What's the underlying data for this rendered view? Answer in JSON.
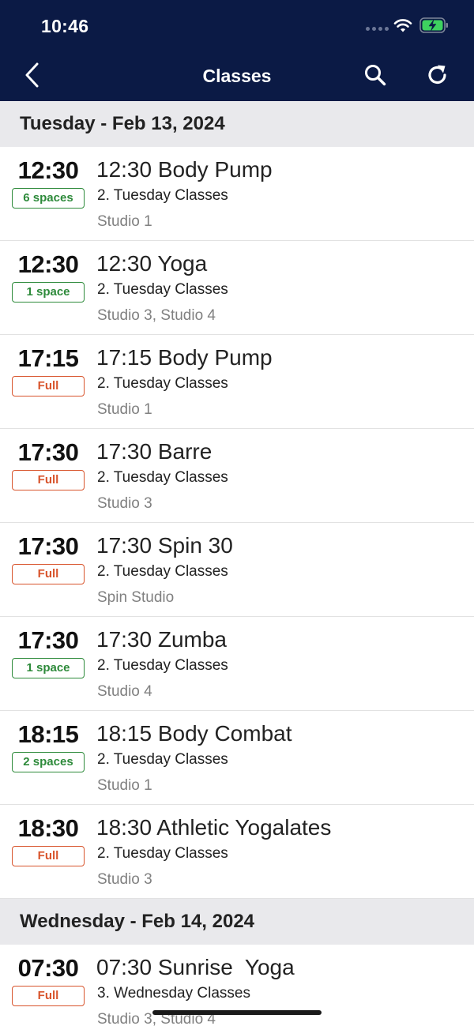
{
  "status_bar": {
    "time": "10:46"
  },
  "nav": {
    "title": "Classes"
  },
  "sections": [
    {
      "date": "Tuesday - Feb 13, 2024",
      "rows": [
        {
          "time": "12:30",
          "badge": "6 spaces",
          "badge_status": "available",
          "name": "12:30 Body Pump",
          "group": "2. Tuesday Classes",
          "room": "Studio 1"
        },
        {
          "time": "12:30",
          "badge": "1 space",
          "badge_status": "available",
          "name": "12:30 Yoga",
          "group": "2. Tuesday Classes",
          "room": "Studio 3, Studio 4"
        },
        {
          "time": "17:15",
          "badge": "Full",
          "badge_status": "full",
          "name": "17:15 Body Pump",
          "group": "2. Tuesday Classes",
          "room": "Studio 1"
        },
        {
          "time": "17:30",
          "badge": "Full",
          "badge_status": "full",
          "name": "17:30 Barre",
          "group": "2. Tuesday Classes",
          "room": "Studio 3"
        },
        {
          "time": "17:30",
          "badge": "Full",
          "badge_status": "full",
          "name": "17:30 Spin 30",
          "group": "2. Tuesday Classes",
          "room": "Spin Studio"
        },
        {
          "time": "17:30",
          "badge": "1 space",
          "badge_status": "available",
          "name": "17:30 Zumba",
          "group": "2. Tuesday Classes",
          "room": "Studio 4"
        },
        {
          "time": "18:15",
          "badge": "2 spaces",
          "badge_status": "available",
          "name": "18:15 Body Combat",
          "group": "2. Tuesday Classes",
          "room": "Studio 1"
        },
        {
          "time": "18:30",
          "badge": "Full",
          "badge_status": "full",
          "name": "18:30 Athletic Yogalates",
          "group": "2. Tuesday Classes",
          "room": "Studio 3"
        }
      ]
    },
    {
      "date": "Wednesday - Feb 14, 2024",
      "rows": [
        {
          "time": "07:30",
          "badge": "Full",
          "badge_status": "full",
          "name": "07:30 Sunrise  Yoga",
          "group": "3. Wednesday Classes",
          "room": "Studio 3, Studio 4"
        }
      ]
    }
  ],
  "colors": {
    "header_bg": "#0b1a45",
    "available": "#2d8a3a",
    "full": "#d8542c",
    "section_bg": "#e9e9ec"
  },
  "icons": {
    "back": "chevron-left-icon",
    "search": "search-icon",
    "refresh": "refresh-icon",
    "wifi": "wifi-icon",
    "battery": "battery-charging-icon"
  }
}
